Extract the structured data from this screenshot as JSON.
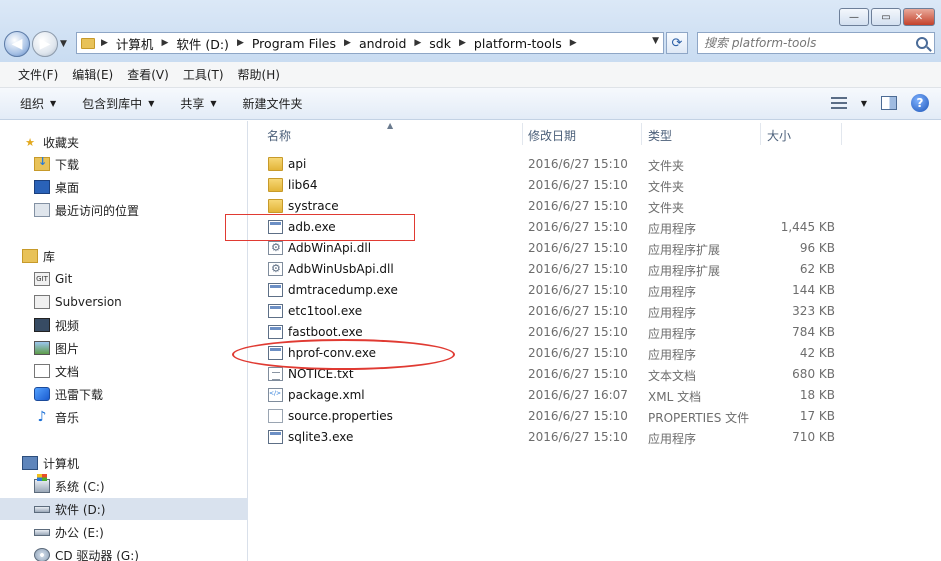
{
  "window": {
    "controls": {
      "minimize": "—",
      "maximize": "▭",
      "close": "✕"
    }
  },
  "address": {
    "crumbs": [
      "计算机",
      "软件 (D:)",
      "Program Files",
      "android",
      "sdk",
      "platform-tools"
    ]
  },
  "search": {
    "placeholder": "搜索 platform-tools"
  },
  "menu": [
    "文件(F)",
    "编辑(E)",
    "查看(V)",
    "工具(T)",
    "帮助(H)"
  ],
  "commands": {
    "organize": "组织",
    "include_in_library": "包含到库中",
    "share": "共享",
    "new_folder": "新建文件夹"
  },
  "nav": {
    "favorites": {
      "label": "收藏夹",
      "items": [
        "下载",
        "桌面",
        "最近访问的位置"
      ]
    },
    "libraries": {
      "label": "库",
      "items": [
        "Git",
        "Subversion",
        "视频",
        "图片",
        "文档",
        "迅雷下载",
        "音乐"
      ]
    },
    "computer": {
      "label": "计算机",
      "items": [
        "系统 (C:)",
        "软件 (D:)",
        "办公 (E:)",
        "CD 驱动器 (G:)"
      ],
      "selected": "软件 (D:)"
    }
  },
  "columns": {
    "name": "名称",
    "date": "修改日期",
    "type": "类型",
    "size": "大小"
  },
  "files": [
    {
      "name": "api",
      "date": "2016/6/27 15:10",
      "type": "文件夹",
      "size": "",
      "icon": "folder-icon"
    },
    {
      "name": "lib64",
      "date": "2016/6/27 15:10",
      "type": "文件夹",
      "size": "",
      "icon": "folder-icon"
    },
    {
      "name": "systrace",
      "date": "2016/6/27 15:10",
      "type": "文件夹",
      "size": "",
      "icon": "folder-icon"
    },
    {
      "name": "adb.exe",
      "date": "2016/6/27 15:10",
      "type": "应用程序",
      "size": "1,445 KB",
      "icon": "exe-icon"
    },
    {
      "name": "AdbWinApi.dll",
      "date": "2016/6/27 15:10",
      "type": "应用程序扩展",
      "size": "96 KB",
      "icon": "dll-icon"
    },
    {
      "name": "AdbWinUsbApi.dll",
      "date": "2016/6/27 15:10",
      "type": "应用程序扩展",
      "size": "62 KB",
      "icon": "dll-icon"
    },
    {
      "name": "dmtracedump.exe",
      "date": "2016/6/27 15:10",
      "type": "应用程序",
      "size": "144 KB",
      "icon": "exe-icon"
    },
    {
      "name": "etc1tool.exe",
      "date": "2016/6/27 15:10",
      "type": "应用程序",
      "size": "323 KB",
      "icon": "exe-icon"
    },
    {
      "name": "fastboot.exe",
      "date": "2016/6/27 15:10",
      "type": "应用程序",
      "size": "784 KB",
      "icon": "exe-icon"
    },
    {
      "name": "hprof-conv.exe",
      "date": "2016/6/27 15:10",
      "type": "应用程序",
      "size": "42 KB",
      "icon": "exe-icon"
    },
    {
      "name": "NOTICE.txt",
      "date": "2016/6/27 15:10",
      "type": "文本文档",
      "size": "680 KB",
      "icon": "txt-icon"
    },
    {
      "name": "package.xml",
      "date": "2016/6/27 16:07",
      "type": "XML 文档",
      "size": "18 KB",
      "icon": "xml-icon"
    },
    {
      "name": "source.properties",
      "date": "2016/6/27 15:10",
      "type": "PROPERTIES 文件",
      "size": "17 KB",
      "icon": "file-icon"
    },
    {
      "name": "sqlite3.exe",
      "date": "2016/6/27 15:10",
      "type": "应用程序",
      "size": "710 KB",
      "icon": "exe-icon"
    }
  ],
  "annotations": {
    "color": "#e03a32",
    "highlighted": [
      "adb.exe",
      "hprof-conv.exe"
    ]
  }
}
